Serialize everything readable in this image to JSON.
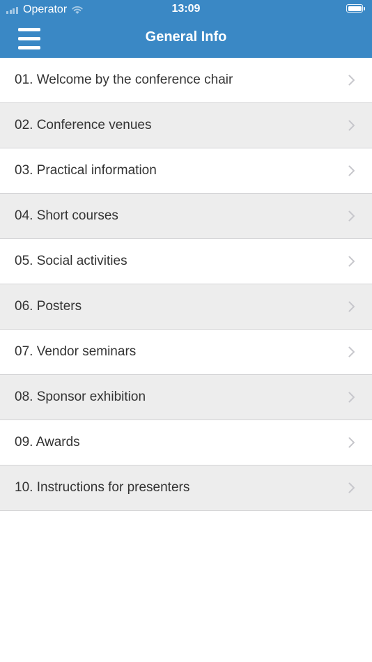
{
  "status_bar": {
    "carrier": "Operator",
    "time": "13:09"
  },
  "nav": {
    "title": "General Info"
  },
  "items": [
    {
      "label": "01. Welcome by the conference chair"
    },
    {
      "label": "02. Conference venues"
    },
    {
      "label": "03. Practical information"
    },
    {
      "label": "04. Short courses"
    },
    {
      "label": "05. Social activities"
    },
    {
      "label": "06. Posters"
    },
    {
      "label": "07. Vendor seminars"
    },
    {
      "label": "08. Sponsor exhibition"
    },
    {
      "label": "09. Awards"
    },
    {
      "label": "10. Instructions for presenters"
    }
  ],
  "colors": {
    "header": "#3a88c5",
    "row_alt": "#ededed",
    "text": "#333333",
    "chevron": "#c7c7cc"
  },
  "icons": {
    "menu": "hamburger-menu-icon",
    "row_disclosure": "chevron-right-icon",
    "signal": "cellular-signal-icon",
    "wifi": "wifi-icon",
    "battery": "battery-icon"
  }
}
